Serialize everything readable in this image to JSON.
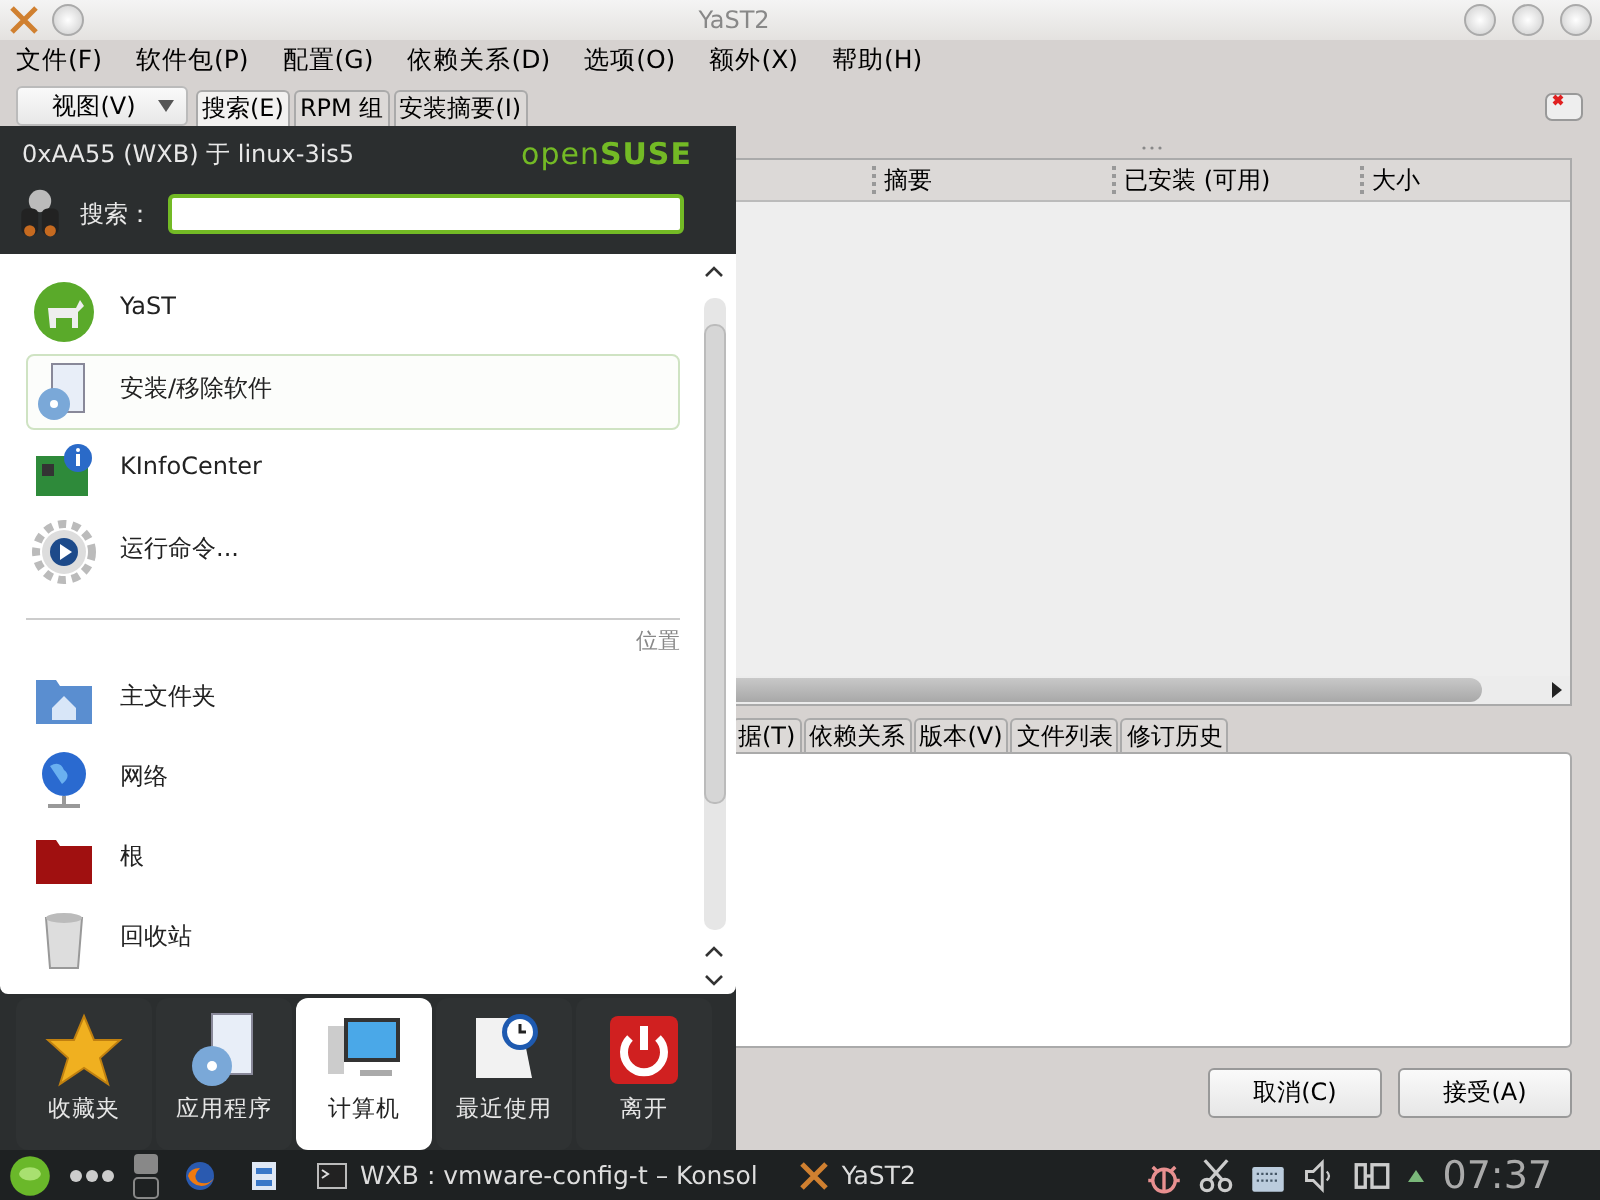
{
  "window": {
    "title": "YaST2"
  },
  "menubar": [
    "文件(F)",
    "软件包(P)",
    "配置(G)",
    "依赖关系(D)",
    "选项(O)",
    "额外(X)",
    "帮助(H)"
  ],
  "view_dropdown": "视图(V)",
  "tabs": [
    {
      "label": "搜索(E)",
      "selected": true
    },
    {
      "label": "RPM 组",
      "selected": false
    },
    {
      "label": "安装摘要(I)",
      "selected": false
    }
  ],
  "package_table": {
    "columns": [
      "摘要",
      "已安装 (可用)",
      "大小"
    ]
  },
  "details_tabs": [
    "据(T)",
    "依赖关系",
    "版本(V)",
    "文件列表",
    "修订历史"
  ],
  "buttons": [
    "取消(C)",
    "接受(A)"
  ],
  "launcher": {
    "user": "0xAA55 (WXB) 于 linux-3is5",
    "brand": "open**SUSE**",
    "search_label": "搜索：",
    "sections": [
      {
        "items": [
          {
            "label": "YaST",
            "selected": false
          },
          {
            "label": "安装/移除软件",
            "selected": true
          },
          {
            "label": "KInfoCenter",
            "selected": false
          },
          {
            "label": "运行命令...",
            "selected": false
          }
        ]
      },
      {
        "heading": "位置",
        "items": [
          {
            "label": "主文件夹",
            "selected": false
          },
          {
            "label": "网络",
            "selected": false
          },
          {
            "label": "根",
            "selected": false
          },
          {
            "label": "回收站",
            "selected": false
          }
        ]
      }
    ],
    "tabs": [
      {
        "label": "收藏夹",
        "selected": false
      },
      {
        "label": "应用程序",
        "selected": false
      },
      {
        "label": "计算机",
        "selected": true
      },
      {
        "label": "最近使用",
        "selected": false
      },
      {
        "label": "离开",
        "selected": false
      }
    ]
  },
  "taskbar": {
    "tasks": [
      {
        "label": "WXB : vmware-config-t – Konsol"
      },
      {
        "label": "YaST2"
      }
    ],
    "clock": "07:37"
  }
}
